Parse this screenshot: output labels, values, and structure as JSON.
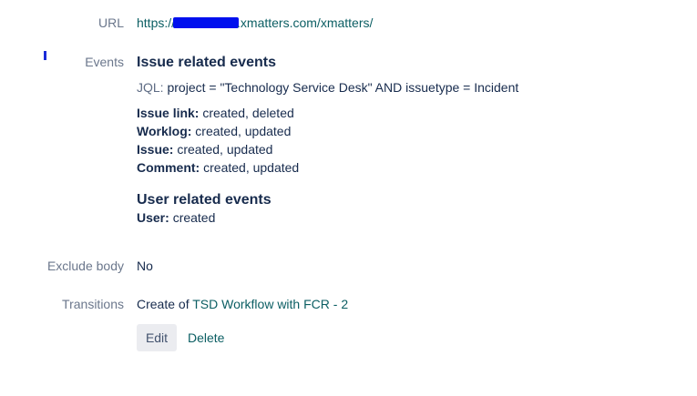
{
  "url_row": {
    "label": "URL",
    "value_prefix": "https://",
    "value_suffix": ".xmatters.com/xmatters/"
  },
  "events_row": {
    "label": "Events",
    "issue_heading": "Issue related events",
    "jql_label": "JQL:",
    "jql_query": "project = \"Technology Service Desk\" AND issuetype = Incident",
    "issue_events": [
      {
        "name": "Issue link:",
        "actions": "created, deleted"
      },
      {
        "name": "Worklog:",
        "actions": "created, updated"
      },
      {
        "name": "Issue:",
        "actions": "created, updated"
      },
      {
        "name": "Comment:",
        "actions": "created, updated"
      }
    ],
    "user_heading": "User related events",
    "user_events": [
      {
        "name": "User:",
        "actions": "created"
      }
    ]
  },
  "exclude_row": {
    "label": "Exclude body",
    "value": "No"
  },
  "transitions_row": {
    "label": "Transitions",
    "prefix": "Create of ",
    "link_text": "TSD Workflow with FCR - 2"
  },
  "actions": {
    "edit_label": "Edit",
    "delete_label": "Delete"
  },
  "colors": {
    "label_gray": "#6b778c",
    "text": "#172b4d",
    "link": "#0b5e63",
    "redaction": "#0010ee"
  }
}
